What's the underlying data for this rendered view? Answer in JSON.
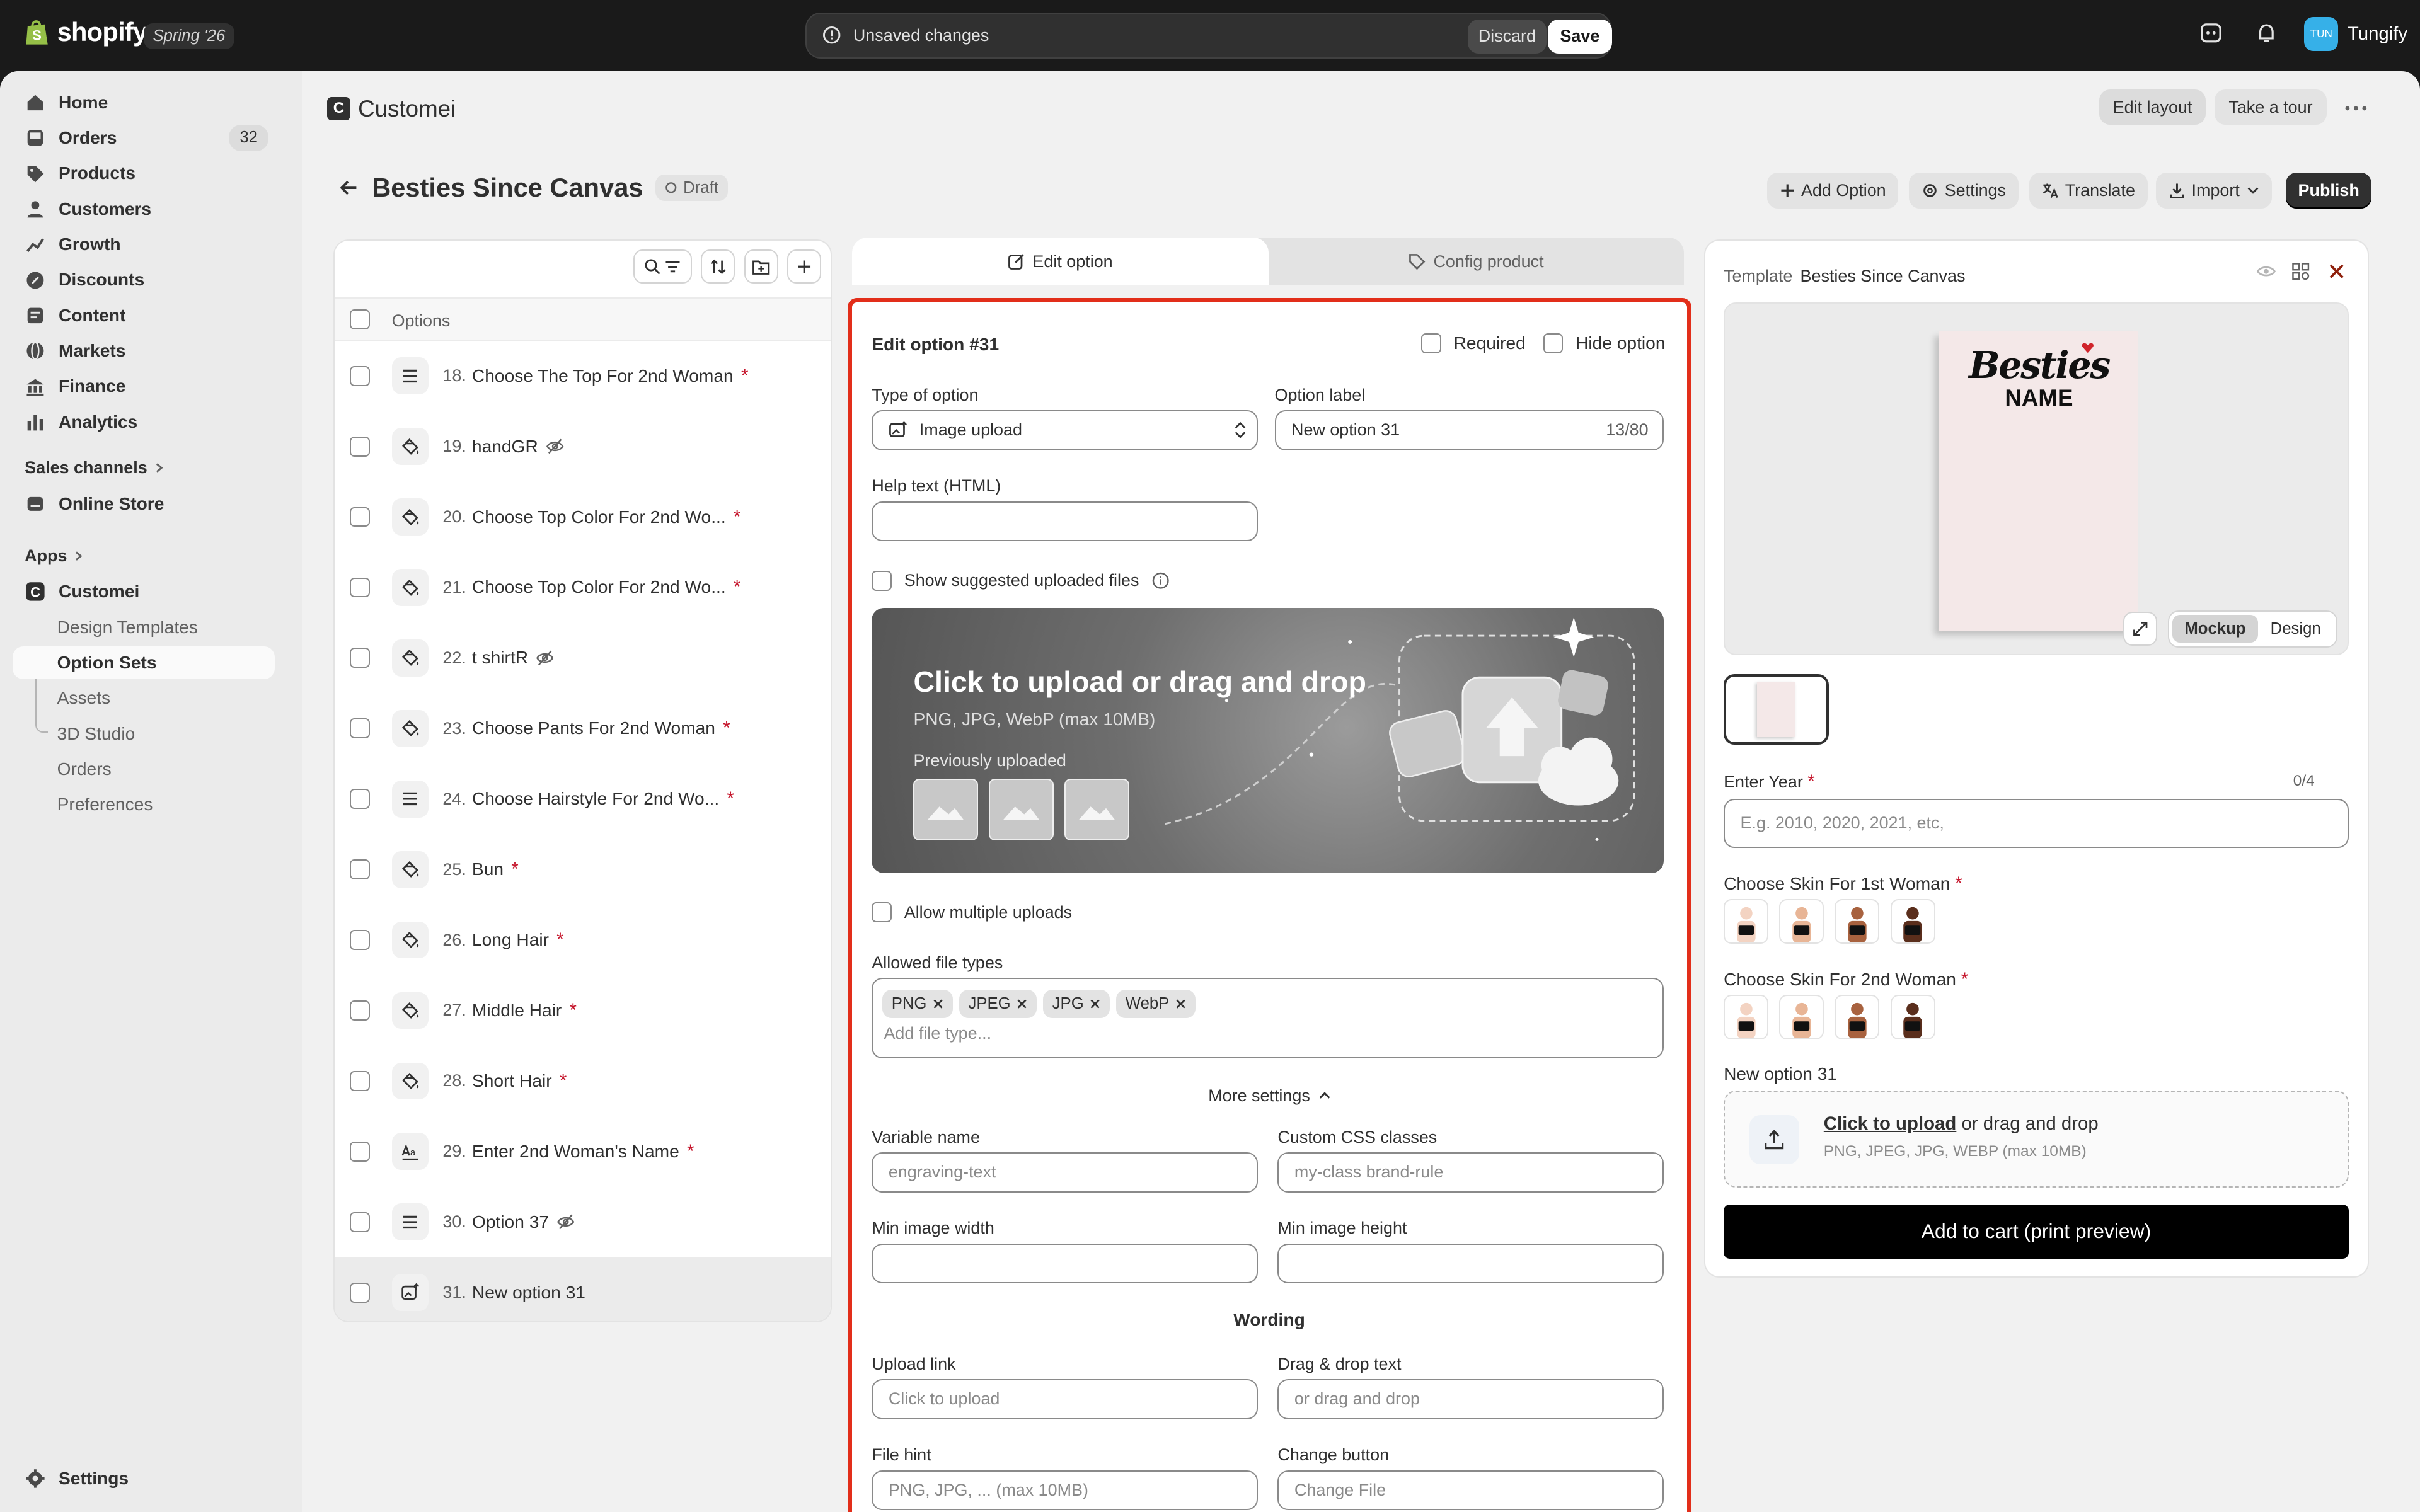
{
  "topbar": {
    "brand": "shopify",
    "season": "Spring '26",
    "unsaved": "Unsaved changes",
    "discard": "Discard",
    "save": "Save",
    "store_initials": "TUN",
    "store_name": "Tungify"
  },
  "sidebar": {
    "items": [
      {
        "label": "Home",
        "icon": "home-icon"
      },
      {
        "label": "Orders",
        "icon": "inbox-icon",
        "badge": "32"
      },
      {
        "label": "Products",
        "icon": "tag-icon"
      },
      {
        "label": "Customers",
        "icon": "person-icon"
      },
      {
        "label": "Growth",
        "icon": "growth-icon"
      },
      {
        "label": "Discounts",
        "icon": "discount-icon"
      },
      {
        "label": "Content",
        "icon": "content-icon"
      },
      {
        "label": "Markets",
        "icon": "globe-icon"
      },
      {
        "label": "Finance",
        "icon": "bank-icon"
      },
      {
        "label": "Analytics",
        "icon": "bar-chart-icon"
      }
    ],
    "sales_channels": "Sales channels",
    "online_store": "Online Store",
    "apps": "Apps",
    "app_name": "Customei",
    "app_sub": [
      "Design Templates",
      "Option Sets",
      "Assets",
      "3D Studio",
      "Orders",
      "Preferences"
    ],
    "settings": "Settings"
  },
  "header": {
    "app_title": "Customei",
    "app_logo": "C",
    "edit_layout": "Edit layout",
    "take_tour": "Take a tour"
  },
  "page": {
    "title": "Besties Since Canvas",
    "status": "Draft",
    "actions": {
      "add_option": "Add Option",
      "settings": "Settings",
      "translate": "Translate",
      "import": "Import",
      "publish": "Publish"
    }
  },
  "options": {
    "header": "Options",
    "rows": [
      {
        "num": "18.",
        "label": "Choose The Top For 2nd Woman",
        "required": true,
        "hidden": false,
        "icon": "list-icon"
      },
      {
        "num": "19.",
        "label": "handGR",
        "required": false,
        "hidden": true,
        "icon": "paint-icon"
      },
      {
        "num": "20.",
        "label": "Choose Top Color For 2nd Wo...",
        "required": true,
        "hidden": false,
        "icon": "paint-icon"
      },
      {
        "num": "21.",
        "label": "Choose Top Color For 2nd Wo...",
        "required": true,
        "hidden": false,
        "icon": "paint-icon"
      },
      {
        "num": "22.",
        "label": "t shirtR",
        "required": false,
        "hidden": true,
        "icon": "paint-icon"
      },
      {
        "num": "23.",
        "label": "Choose Pants For 2nd Woman",
        "required": true,
        "hidden": false,
        "icon": "paint-icon"
      },
      {
        "num": "24.",
        "label": "Choose Hairstyle For 2nd Wo...",
        "required": true,
        "hidden": false,
        "icon": "list-icon"
      },
      {
        "num": "25.",
        "label": "Bun",
        "required": true,
        "hidden": false,
        "icon": "paint-icon"
      },
      {
        "num": "26.",
        "label": "Long Hair",
        "required": true,
        "hidden": false,
        "icon": "paint-icon"
      },
      {
        "num": "27.",
        "label": "Middle Hair",
        "required": true,
        "hidden": false,
        "icon": "paint-icon"
      },
      {
        "num": "28.",
        "label": "Short Hair",
        "required": true,
        "hidden": false,
        "icon": "paint-icon"
      },
      {
        "num": "29.",
        "label": "Enter 2nd Woman's Name",
        "required": true,
        "hidden": false,
        "icon": "text-icon"
      },
      {
        "num": "30.",
        "label": "Option 37",
        "required": false,
        "hidden": true,
        "icon": "list-icon"
      },
      {
        "num": "31.",
        "label": "New option 31",
        "required": false,
        "hidden": false,
        "icon": "image-upload-icon"
      }
    ]
  },
  "editor": {
    "tab_edit": "Edit option",
    "tab_config": "Config product",
    "title": "Edit option #31",
    "required": "Required",
    "hide_option": "Hide option",
    "type_label": "Type of option",
    "type_value": "Image upload",
    "option_label_label": "Option label",
    "option_label_value": "New option 31",
    "option_label_count": "13/80",
    "help_label": "Help text (HTML)",
    "show_suggested": "Show suggested uploaded files",
    "upload_title": "Click to upload or drag and drop",
    "upload_sub": "PNG, JPG, WebP (max 10MB)",
    "previously": "Previously uploaded",
    "allow_multiple": "Allow multiple uploads",
    "allowed_types_label": "Allowed file types",
    "file_types": [
      "PNG",
      "JPEG",
      "JPG",
      "WebP"
    ],
    "add_type_placeholder": "Add file type...",
    "more_settings": "More settings",
    "variable_name_label": "Variable name",
    "variable_name_ph": "engraving-text",
    "css_label": "Custom CSS classes",
    "css_ph": "my-class brand-rule",
    "min_w_label": "Min image width",
    "min_h_label": "Min image height",
    "wording": "Wording",
    "upload_link_label": "Upload link",
    "upload_link_ph": "Click to upload",
    "drag_label": "Drag & drop text",
    "drag_ph": "or drag and drop",
    "file_hint_label": "File hint",
    "file_hint_ph": "PNG, JPG, ... (max 10MB)",
    "change_label": "Change button",
    "change_ph": "Change File"
  },
  "preview": {
    "template_label": "Template",
    "template_name": "Besties Since Canvas",
    "canvas_title": "Besties",
    "canvas_name": "NAME",
    "mockup": "Mockup",
    "design": "Design",
    "year_label": "Enter Year",
    "year_count": "0/4",
    "year_ph": "E.g. 2010, 2020, 2021, etc,",
    "skin1_label": "Choose Skin For 1st Woman",
    "skin2_label": "Choose Skin For 2nd Woman",
    "skin_colors": [
      "#f3d3c2",
      "#e8b596",
      "#a8623f",
      "#5a2e1c"
    ],
    "new_option_label": "New option 31",
    "upload_link": "Click to upload",
    "upload_rest": "or drag and drop",
    "upload_hint": "PNG, JPEG, JPG, WEBP (max 10MB)",
    "add_to_cart": "Add to cart (print preview)"
  }
}
